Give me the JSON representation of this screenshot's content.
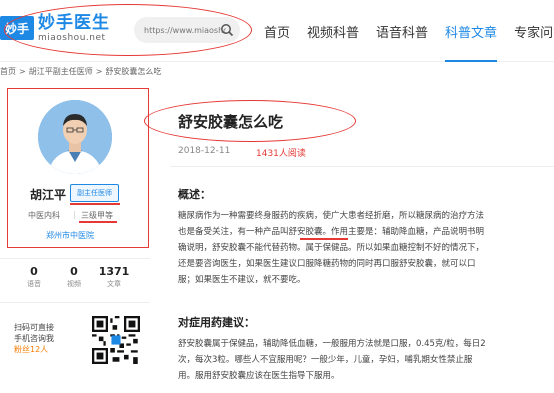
{
  "header": {
    "logo_badge": "妙手",
    "logo_name": "妙手医生",
    "logo_domain": "miaoshou.net",
    "search_placeholder": "https://www.miaoshou",
    "nav": [
      "首页",
      "视频科普",
      "语音科普",
      "科普文章",
      "专家问答"
    ],
    "active_nav": 3
  },
  "breadcrumb": [
    "首页",
    ">",
    "胡江平副主任医师",
    ">",
    "舒安胶囊怎么吃"
  ],
  "doctor": {
    "name": "胡江平",
    "title": "副主任医师",
    "department": "中医内科",
    "separator": "|",
    "level": "三级甲等",
    "hospital": "郑州市中医院",
    "stats": [
      {
        "num": "0",
        "label": "语音"
      },
      {
        "num": "0",
        "label": "视频"
      },
      {
        "num": "1371",
        "label": "文章"
      }
    ],
    "qr_line1": "扫码可直接",
    "qr_line2": "手机咨询我",
    "qr_fans": "粉丝12人"
  },
  "article": {
    "title": "舒安胶囊怎么吃",
    "date": "2018-12-11",
    "views": "1431人阅读",
    "sections": [
      {
        "heading": "概述：",
        "lines": [
          "糖尿病作为一种需要终身服药的疾病，使广大患者经折磨，所以糖尿病的治疗方法",
          "也是备受关注，有一种产品叫舒安胶囊。作用主要是：辅助降血糖，产品说明书明",
          "确说明，舒安胶囊不能代替药物。属于保健品。所以如果血糖控制不好的情况下，",
          "还是要咨询医生，如果医生建议口服降糖药物的同时再口服舒安胶囊，就可以口",
          "服；如果医生不建议，就不要吃。"
        ]
      },
      {
        "heading": "对症用药建议：",
        "lines": [
          "舒安胶囊属于保健品，辅助降低血糖，一般服用方法就是口服，0.45克/粒，每日2",
          "次，每次3粒。哪些人不宜服用呢？一般少年，儿童，孕妇，哺乳期女性禁止服",
          "用。服用舒安胶囊应该在医生指导下服用。"
        ]
      }
    ]
  },
  "colors": {
    "brand": "#1e88e5",
    "annotation": "#e53935",
    "fans": "#f57c00"
  }
}
